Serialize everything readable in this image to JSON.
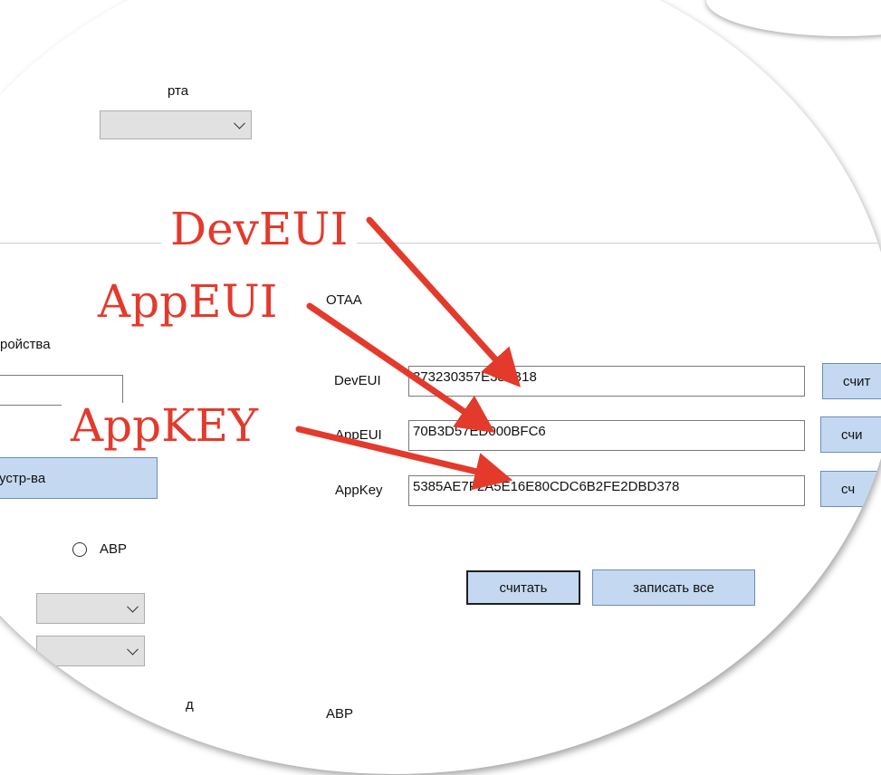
{
  "top_partial_label": "рта",
  "device_partial_label": "ройства",
  "device_button_label": "устр-ва",
  "radio_abp_label": "ABP",
  "otaa": {
    "title": "OTAA",
    "fields": [
      {
        "label": "DevEUI",
        "value": "373230357E387B18",
        "read_button": "счит"
      },
      {
        "label": "AppEUI",
        "value": "70B3D57ED000BFC6",
        "read_button": "счи"
      },
      {
        "label": "AppKey",
        "value": "5385AE7F2A5E16E80CDC6B2FE2DBD378",
        "read_button": "сч"
      }
    ],
    "read_all_button": "считать",
    "write_all_button": "записать все"
  },
  "bottom_partial_label": "д",
  "abp_section_title": "ABP",
  "annotations": [
    "DevEUI",
    "AppEUI",
    "AppKEY"
  ],
  "colors": {
    "annotation": "#e33a2c",
    "button_bg": "#c4d9f1"
  }
}
